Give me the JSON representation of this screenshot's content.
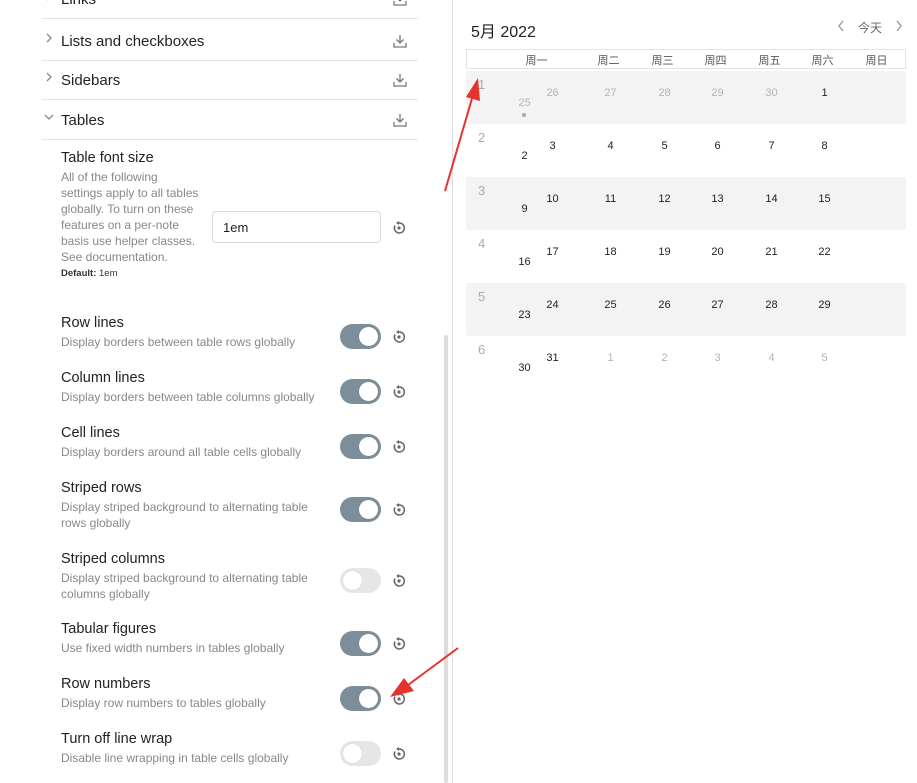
{
  "settings": {
    "sections": [
      {
        "label": "Links",
        "expanded": false
      },
      {
        "label": "Lists and checkboxes",
        "expanded": false
      },
      {
        "label": "Sidebars",
        "expanded": false
      },
      {
        "label": "Tables",
        "expanded": true
      }
    ],
    "table_font_size": {
      "title": "Table font size",
      "description": "All of the following settings apply to all tables globally. To turn on these features on a per-note basis use helper classes. See documentation.",
      "default_label": "Default:",
      "default_value": "1em",
      "value": "1em"
    },
    "toggles": [
      {
        "title": "Row lines",
        "description": "Display borders between table rows globally",
        "on": true
      },
      {
        "title": "Column lines",
        "description": "Display borders between table columns globally",
        "on": true
      },
      {
        "title": "Cell lines",
        "description": "Display borders around all table cells globally",
        "on": true
      },
      {
        "title": "Striped rows",
        "description": "Display striped background to alternating table rows globally",
        "on": true
      },
      {
        "title": "Striped columns",
        "description": "Display striped background to alternating table columns globally",
        "on": false
      },
      {
        "title": "Tabular figures",
        "description": "Use fixed width numbers in tables globally",
        "on": true
      },
      {
        "title": "Row numbers",
        "description": "Display row numbers to tables globally",
        "on": true
      },
      {
        "title": "Turn off line wrap",
        "description": "Disable line wrapping in table cells globally",
        "on": false
      }
    ]
  },
  "calendar": {
    "title": "5月 2022",
    "today_label": "今天",
    "weekdays": [
      "周一",
      "周二",
      "周三",
      "周四",
      "周五",
      "周六",
      "周日"
    ],
    "weeks": [
      {
        "week": "1",
        "days": [
          "25",
          "26",
          "27",
          "28",
          "29",
          "30",
          "1"
        ],
        "dim": [
          true,
          true,
          true,
          true,
          true,
          true,
          false
        ],
        "shaded": true
      },
      {
        "week": "2",
        "days": [
          "2",
          "3",
          "4",
          "5",
          "6",
          "7",
          "8"
        ],
        "dim": [
          false,
          false,
          false,
          false,
          false,
          false,
          false
        ],
        "shaded": false
      },
      {
        "week": "3",
        "days": [
          "9",
          "10",
          "11",
          "12",
          "13",
          "14",
          "15"
        ],
        "dim": [
          false,
          false,
          false,
          false,
          false,
          false,
          false
        ],
        "shaded": true
      },
      {
        "week": "4",
        "days": [
          "16",
          "17",
          "18",
          "19",
          "20",
          "21",
          "22"
        ],
        "dim": [
          false,
          false,
          false,
          false,
          false,
          false,
          false
        ],
        "shaded": false
      },
      {
        "week": "5",
        "days": [
          "23",
          "24",
          "25",
          "26",
          "27",
          "28",
          "29"
        ],
        "dim": [
          false,
          false,
          false,
          false,
          false,
          false,
          false
        ],
        "shaded": true
      },
      {
        "week": "6",
        "days": [
          "30",
          "31",
          "1",
          "2",
          "3",
          "4",
          "5"
        ],
        "dim": [
          false,
          false,
          true,
          true,
          true,
          true,
          true
        ],
        "shaded": false
      }
    ]
  },
  "colors": {
    "toggle_on": "#7b8e9a",
    "toggle_off": "#e6e6e6",
    "annotation_arrow": "#e8322e"
  }
}
